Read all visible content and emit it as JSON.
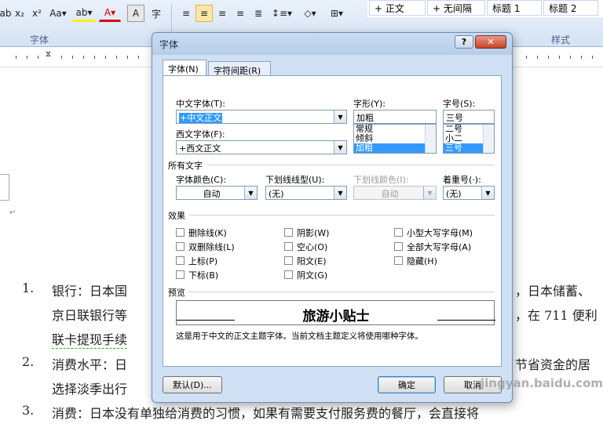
{
  "ribbon": {
    "font_group_label": "字体",
    "style_group_label": "样式",
    "fmt_buttons": [
      "ab",
      "x₂",
      "x²",
      "Aa▾",
      "ab▾",
      "A▾",
      "A",
      "字"
    ],
    "styles": [
      "+ 正文",
      "+ 无间隔",
      "标题 1",
      "标题 2"
    ]
  },
  "document": {
    "items": [
      {
        "num": "1.",
        "lines": [
          "银行：日本国",
          "京日联银行等",
          "联卡提现手续"
        ],
        "right": [
          "，日本储蓄、",
          "，在 711 便利"
        ]
      },
      {
        "num": "2.",
        "lines": [
          "消费水平：日",
          "选择淡季出行"
        ],
        "right": [
          "节省资金的居"
        ]
      },
      {
        "num": "3.",
        "lines": [
          "消费：日本没有单独给消费的习惯，如果有需要支付服务费的餐厅，会直接将"
        ]
      }
    ]
  },
  "dialog": {
    "title": "字体",
    "tabs": [
      "字体(N)",
      "字符间距(R)"
    ],
    "cn_font_label": "中文字体(T):",
    "cn_font_value": "+中文正文",
    "west_font_label": "西文字体(F):",
    "west_font_value": "+西文正文",
    "style_label": "字形(Y):",
    "style_value": "加粗",
    "style_options": [
      "常规",
      "倾斜",
      "加粗"
    ],
    "size_label": "字号(S):",
    "size_value": "三号",
    "size_options": [
      "二号",
      "小二",
      "三号"
    ],
    "all_text_label": "所有文字",
    "color_label": "字体颜色(C):",
    "color_value": "自动",
    "underline_label": "下划线线型(U):",
    "underline_value": "(无)",
    "ucolor_label": "下划线颜色(I):",
    "ucolor_value": "自动",
    "emph_label": "着重号(·):",
    "emph_value": "(无)",
    "effects_label": "效果",
    "effects": [
      "删除线(K)",
      "双删除线(L)",
      "上标(P)",
      "下标(B)",
      "阴影(W)",
      "空心(O)",
      "阳文(E)",
      "阴文(G)",
      "小型大写字母(M)",
      "全部大写字母(A)",
      "隐藏(H)"
    ],
    "preview_label": "预览",
    "preview_text": "旅游小贴士",
    "note": "这是用于中文的正文主题字体。当前文档主题定义将使用哪种字体。",
    "default_btn": "默认(D)...",
    "ok_btn": "确定",
    "cancel_btn": "取消"
  },
  "watermark": "jingyan.baidu.com"
}
